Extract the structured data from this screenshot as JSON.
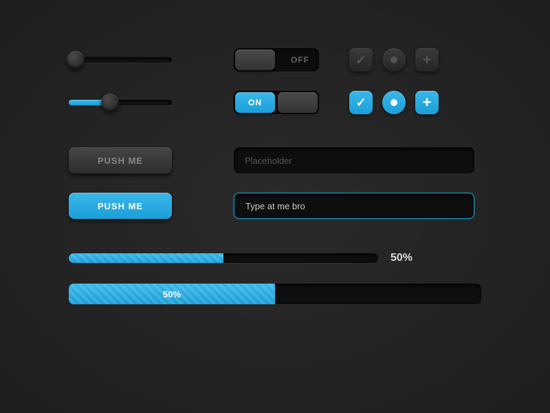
{
  "sliders": [
    {
      "value_pct": 5
    },
    {
      "value_pct": 40
    }
  ],
  "toggles": [
    {
      "state": "off",
      "label_on": "ON",
      "label_off": "OFF"
    },
    {
      "state": "on",
      "label_on": "ON",
      "label_off": "OFF"
    }
  ],
  "buttons": {
    "dark_label": "PUSH ME",
    "blue_label": "PUSH ME"
  },
  "inputs": {
    "placeholder": "Placeholder",
    "focused_value": "Type at me bro"
  },
  "progress": {
    "small_pct": 50,
    "small_label": "50%",
    "big_pct": 50,
    "big_label": "50%"
  },
  "colors": {
    "accent": "#1fa8dc",
    "bg": "#222222"
  }
}
